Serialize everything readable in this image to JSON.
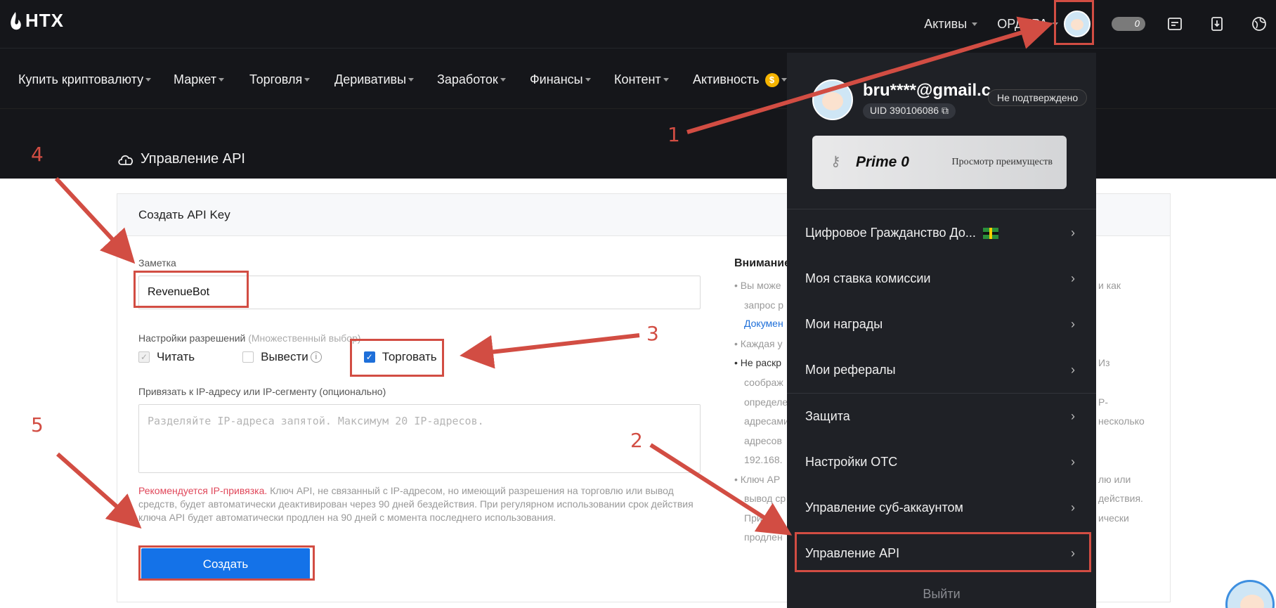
{
  "header": {
    "logo_text": "HTX",
    "assets_label": "Активы",
    "orders_label": "ОРДЕРА",
    "toggle_value": "0"
  },
  "nav": {
    "items": [
      "Купить криптовалюту",
      "Маркет",
      "Торговля",
      "Деривативы",
      "Заработок",
      "Финансы",
      "Контент",
      "Активность"
    ]
  },
  "hero": {
    "title": "Управление API"
  },
  "form": {
    "card_title": "Создать API Key",
    "note_label": "Заметка",
    "note_value": "RevenueBot",
    "perm_label": "Настройки разрешений",
    "perm_hint": "(Множественный выбор)",
    "perm_read": "Читать",
    "perm_withdraw": "Вывести",
    "perm_trade": "Торговать",
    "ip_label": "Привязать к IP-адресу или IP-сегменту (опционально)",
    "ip_placeholder": "Разделяйте IP-адреса запятой. Максимум 20 IP-адресов.",
    "warn_red": "Рекомендуется IP-привязка.",
    "warn_text": " Ключ API, не связанный с IP-адресом, но имеющий разрешения на торговлю или вывод средств, будет автоматически деактивирован через 90 дней бездействия. При регулярном использовании срок действия ключа API будет автоматически продлен на 90 дней с момента последнего использования.",
    "create_label": "Создать"
  },
  "attention": {
    "title": "Внимание",
    "lines": [
      "• Вы може",
      "запрос р",
      "Докумен",
      "• Каждая у",
      "• Не раскр",
      "соображ",
      "определе",
      "адресами",
      "адресов",
      "192.168.",
      "• Ключ AP",
      "вывод ср",
      "При",
      "продлен"
    ],
    "right_fragments": [
      "и как",
      "Из",
      "P-",
      "несколько",
      "лю или",
      "действия.",
      "ически"
    ]
  },
  "dropdown": {
    "email": "bru****@gmail.c",
    "uid": "UID  390106086",
    "verify_badge": "Не подтверждено",
    "prime_title": "Prime 0",
    "prime_link": "Просмотр преимуществ",
    "items": [
      "Цифровое Гражданство До...",
      "Моя ставка комиссии",
      "Мои награды",
      "Мои рефералы",
      "Защита",
      "Настройки OTC",
      "Управление суб-аккаунтом",
      "Управление API"
    ],
    "logout": "Выйти"
  },
  "annotations": [
    "1",
    "2",
    "3",
    "4",
    "5"
  ],
  "colors": {
    "header_bg": "#15161a",
    "dropdown_bg": "#1f2126",
    "annotation_red": "#d24d43",
    "primary_blue": "#1472e8"
  }
}
